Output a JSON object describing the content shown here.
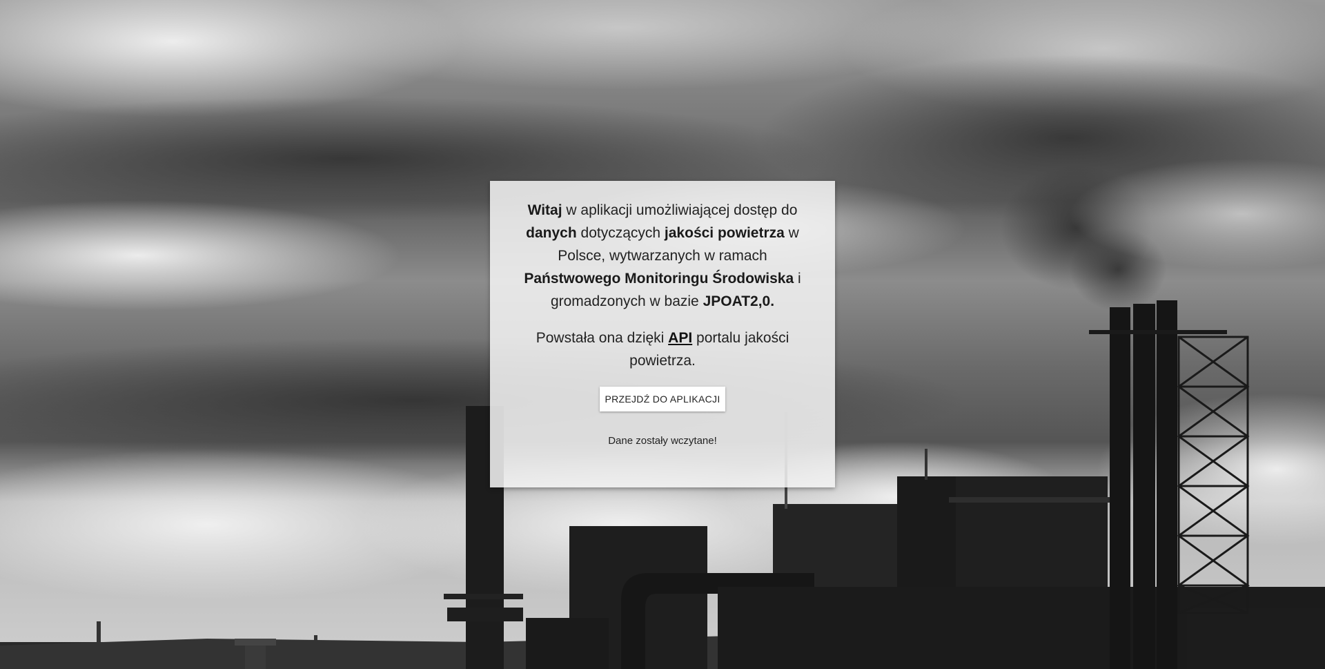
{
  "welcome": {
    "bold_greeting": "Witaj",
    "text_1": " w aplikacji umożliwiającej dostęp do ",
    "bold_data": "danych",
    "text_2": " dotyczących ",
    "bold_air_quality": "jakości powietrza",
    "text_3": " w Polsce, wytwarzanych w ramach ",
    "bold_monitoring": "Państwowego Monitoringu Środowiska",
    "text_4": " i gromadzonych w bazie ",
    "bold_database": "JPOAT2,0."
  },
  "origin": {
    "text_before": "Powstała ona dzięki ",
    "api_link": "API",
    "text_after": " portalu jakości powietrza."
  },
  "actions": {
    "go_to_app_label": "PRZEJDŹ DO APLIKACJI"
  },
  "status": {
    "message": "Dane zostały wczytane!"
  },
  "background": {
    "description_icon": "industrial-skyline-image",
    "tone": "grayscale"
  }
}
